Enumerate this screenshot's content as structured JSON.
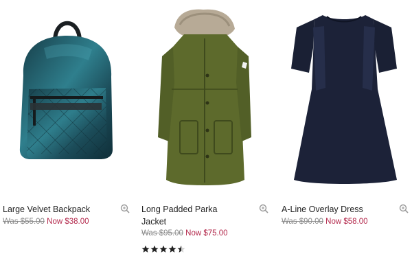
{
  "products": [
    {
      "name": "Large Velvet Backpack",
      "was_price": "Was $55.00",
      "now_price": "Now $38.00",
      "image": "velvet-backpack-image",
      "colors": {
        "main": "#1d4a56",
        "highlight": "#3a8a99"
      }
    },
    {
      "name": "Long Padded Parka Jacket",
      "name_line1": "Long Padded Parka",
      "name_line2": "Jacket",
      "was_price": "Was $95.00",
      "now_price": "Now $75.00",
      "rating": 4.5,
      "rating_max": 5,
      "image": "parka-jacket-image",
      "colors": {
        "main": "#5d6a2c",
        "fur": "#b7aa96"
      }
    },
    {
      "name": "A-Line Overlay Dress",
      "was_price": "Was $90.00",
      "now_price": "Now $58.00",
      "image": "overlay-dress-image",
      "colors": {
        "main": "#1c2238"
      }
    }
  ],
  "colors": {
    "sale": "#b3284b",
    "was": "#8a8a8a",
    "text": "#222222"
  }
}
